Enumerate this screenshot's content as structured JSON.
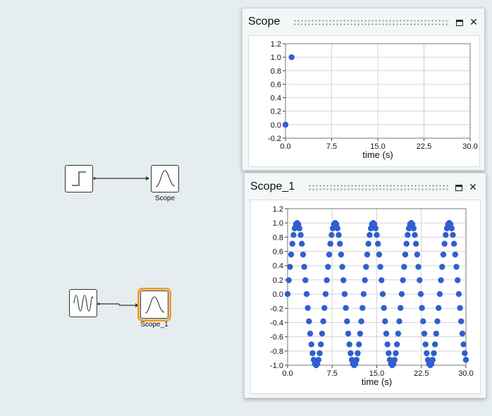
{
  "diagram": {
    "blocks": [
      {
        "id": "step",
        "label": "",
        "icon": "step-icon"
      },
      {
        "id": "scope",
        "label": "Scope",
        "icon": "scope-icon"
      },
      {
        "id": "sine",
        "label": "",
        "icon": "sine-icon"
      },
      {
        "id": "scope_1",
        "label": "Scope_1",
        "icon": "scope-icon",
        "selected": true
      }
    ],
    "selection_color": "#f2a02e"
  },
  "windows": {
    "scope": {
      "title": "Scope",
      "maximize_icon": "maximize-icon",
      "close_label": "✕"
    },
    "scope_1": {
      "title": "Scope_1",
      "maximize_icon": "maximize-icon",
      "close_label": "✕"
    }
  },
  "chart_data": [
    {
      "type": "scatter",
      "title": "",
      "xlabel": "time (s)",
      "ylabel": "",
      "xlim": [
        0,
        30
      ],
      "ylim": [
        -0.2,
        1.2
      ],
      "xticks": [
        "0.0",
        "7.5",
        "15.0",
        "22.5",
        "30.0"
      ],
      "yticks": [
        "1.2",
        "1.0",
        "0.8",
        "0.6",
        "0.4",
        "0.2",
        "0.0",
        "-0.2"
      ],
      "grid": true,
      "color": "#2f5fcf",
      "points": [
        [
          0,
          0
        ],
        [
          1,
          1
        ]
      ]
    },
    {
      "type": "scatter",
      "title": "",
      "xlabel": "time (s)",
      "ylabel": "",
      "xlim": [
        0,
        30
      ],
      "ylim": [
        -1.0,
        1.2
      ],
      "xticks": [
        "0.0",
        "7.5",
        "15.0",
        "22.5",
        "30.0"
      ],
      "yticks": [
        "1.2",
        "1.0",
        "0.8",
        "0.6",
        "0.4",
        "0.2",
        "0.0",
        "-0.2",
        "-0.4",
        "-0.6",
        "-0.8",
        "-1.0"
      ],
      "grid": true,
      "color": "#2f5fcf",
      "function": "sin",
      "period": 6.4,
      "t_start": 0,
      "t_end": 30,
      "t_step": 0.2
    }
  ]
}
